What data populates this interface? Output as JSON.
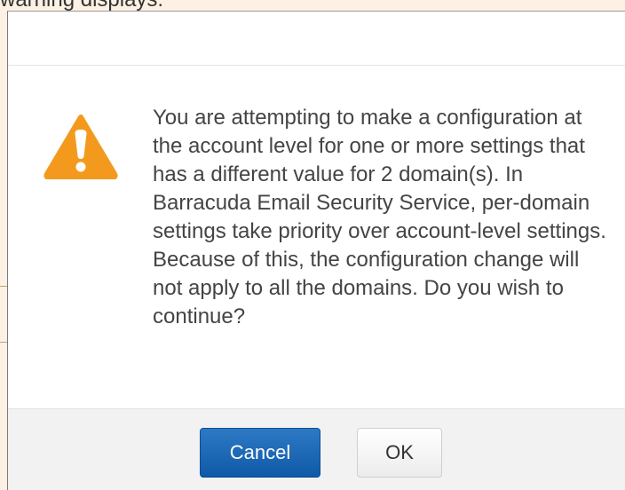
{
  "background_caption": "warning displays:",
  "dialog": {
    "icon": "warning-icon",
    "message": "You are attempting to make a configuration at the account level for one or more settings that has a different value for 2 domain(s). In Barracuda Email Security Service, per-domain settings take priority over account-level settings. Because of this, the configuration change will not apply to all the domains. Do you wish to continue?",
    "buttons": {
      "cancel_label": "Cancel",
      "ok_label": "OK"
    }
  },
  "colors": {
    "warning_orange": "#f39a1e",
    "primary_button": "#1565b8",
    "page_background": "#fdf1e3"
  }
}
